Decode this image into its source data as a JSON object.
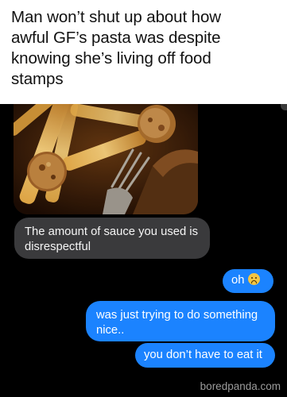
{
  "caption": {
    "line1": "Man won’t shut up about how",
    "line2": "awful GF’s pasta was despite",
    "line3": "knowing she’s living off food",
    "line4": "stamps"
  },
  "messages": {
    "m1": {
      "sender": "other",
      "line1": "The amount of sauce you used is",
      "line2": "disrespectful"
    },
    "m2": {
      "sender": "me",
      "text": "oh",
      "emoji": "frowning-face-icon"
    },
    "m3": {
      "sender": "me",
      "line1": "was just trying to do something",
      "line2": "nice.."
    },
    "m4": {
      "sender": "me",
      "text": "you don’t have to eat it"
    }
  },
  "colors": {
    "sent_bubble": "#1b83ff",
    "received_bubble": "#3a3a3c",
    "background": "#000000"
  },
  "watermark": "boredpanda.com"
}
